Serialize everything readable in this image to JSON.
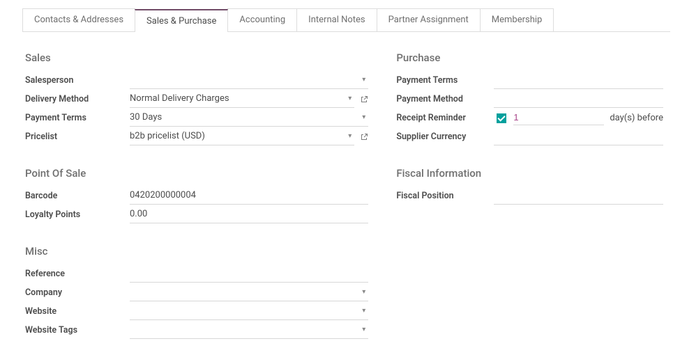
{
  "tabs": {
    "contacts": "Contacts & Addresses",
    "sales": "Sales & Purchase",
    "accounting": "Accounting",
    "notes": "Internal Notes",
    "partner": "Partner Assignment",
    "membership": "Membership"
  },
  "sales": {
    "heading": "Sales",
    "salesperson_label": "Salesperson",
    "salesperson_value": "",
    "delivery_label": "Delivery Method",
    "delivery_value": "Normal Delivery Charges",
    "payment_terms_label": "Payment Terms",
    "payment_terms_value": "30 Days",
    "pricelist_label": "Pricelist",
    "pricelist_value": "b2b pricelist (USD)"
  },
  "pos": {
    "heading": "Point Of Sale",
    "barcode_label": "Barcode",
    "barcode_value": "0420200000004",
    "loyalty_label": "Loyalty Points",
    "loyalty_value": "0.00"
  },
  "misc": {
    "heading": "Misc",
    "reference_label": "Reference",
    "reference_value": "",
    "company_label": "Company",
    "company_value": "",
    "website_label": "Website",
    "website_value": "",
    "website_tags_label": "Website Tags",
    "website_tags_value": ""
  },
  "purchase": {
    "heading": "Purchase",
    "payment_terms_label": "Payment Terms",
    "payment_terms_value": "",
    "payment_method_label": "Payment Method",
    "payment_method_value": "",
    "receipt_label": "Receipt Reminder",
    "receipt_value": "1",
    "receipt_suffix": "day(s) before",
    "supplier_currency_label": "Supplier Currency",
    "supplier_currency_value": ""
  },
  "fiscal": {
    "heading": "Fiscal Information",
    "position_label": "Fiscal Position",
    "position_value": ""
  }
}
